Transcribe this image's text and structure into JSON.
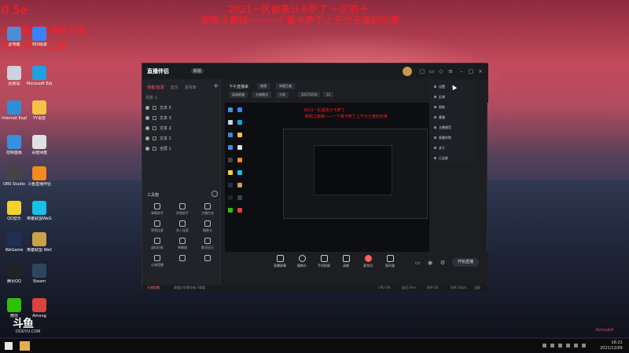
{
  "overlay": {
    "line1": "0.5e",
    "line2": "中国最帅野净胜三盘",
    "line3": "VS大厚 17三盘",
    "line4": "2021一区最高分卡萨丁  一区前十",
    "line5": "昵称之巅峰——一个靠卡萨丁上千分王者的玩家"
  },
  "desktop_icons": [
    {
      "label": "此电脑",
      "color": "#4a8ed6",
      "icon": "computer-icon"
    },
    {
      "label": "360极速",
      "color": "#3b82f6",
      "icon": "browser-icon"
    },
    {
      "label": "回收站",
      "color": "#c8d4e0",
      "icon": "recycle-bin-icon"
    },
    {
      "label": "Microsoft Edge",
      "color": "#1fa0e0",
      "icon": "edge-icon"
    },
    {
      "label": "Internet Explorer",
      "color": "#2d8fd6",
      "icon": "ie-icon"
    },
    {
      "label": "YY语音",
      "color": "#f6c244",
      "icon": "yy-icon"
    },
    {
      "label": "控制面板",
      "color": "#3a8ee0",
      "icon": "control-panel-icon"
    },
    {
      "label": "百度网盘",
      "color": "#e0e0e0",
      "icon": "baidu-netdisk-icon"
    },
    {
      "label": "OBS Studio",
      "color": "#444",
      "icon": "obs-icon"
    },
    {
      "label": "斗鱼直播伴侣",
      "color": "#f58a1f",
      "icon": "douyu-icon"
    },
    {
      "label": "QQ音乐",
      "color": "#f4d22e",
      "icon": "qq-music-icon"
    },
    {
      "label": "英雄联盟WeGame",
      "color": "#17c0e5",
      "icon": "lol-icon"
    },
    {
      "label": "WeGame",
      "color": "#1f2f55",
      "icon": "wegame-icon"
    },
    {
      "label": "英雄联盟 WeGame版",
      "color": "#c8a24c",
      "icon": "lol-wegame-icon"
    },
    {
      "label": "腾讯QQ",
      "color": "#222",
      "icon": "qq-icon"
    },
    {
      "label": "Steam",
      "color": "#2a475e",
      "icon": "steam-icon"
    },
    {
      "label": "微信",
      "color": "#2dc100",
      "icon": "wechat-icon"
    },
    {
      "label": "Among",
      "color": "#d9443b",
      "icon": "among-icon"
    }
  ],
  "window": {
    "title": "直播伴侣",
    "badge": "新版",
    "tabs": [
      "场景/音源",
      "音乐",
      "素材库"
    ],
    "add_scene": "场景 1",
    "sources": [
      "文本 5",
      "文本 3",
      "文本 2",
      "文本 1",
      "全屏 1"
    ],
    "tools_title": "工具箱",
    "tools": [
      "弹幕助手",
      "房管助手",
      "主播任务",
      "视频连麦",
      "多人连麦",
      "摄像头",
      "虚拟形象",
      "弹幕姬",
      "歌词显示",
      "礼物提醒",
      "",
      ""
    ],
    "info_title": "下午直播来",
    "info_chip1": "修改",
    "info_chip2": "申请王者",
    "info_chip3": "英雄联盟",
    "info_chip4": "大神模式",
    "info_chip5": "分享",
    "room_no": "10173216",
    "viewers": "12",
    "menu": [
      "设置",
      "反馈",
      "帮助",
      "客服",
      "主播规范",
      "直播学院",
      "关于",
      "已全屏"
    ],
    "bottom_buttons": [
      "直播屏幕",
      "摄像头",
      "手机投屏",
      "录像",
      "麦克风",
      "扬声器"
    ],
    "start_button": "开始直播",
    "status": [
      "礼物提醒",
      "观看历史等你来下载看",
      "CPU 0%",
      "延迟 0ms",
      "帧率 60",
      "码率 0kb/s"
    ],
    "status_right": "全屏"
  },
  "preview_text": {
    "a": "2021一区最高分卡萨丁",
    "b": "昵称之巅峰——一个靠卡萨丁上千分王者的玩家"
  },
  "taskbar": {
    "time": "16:21",
    "date": "2021/12/09"
  },
  "douyu": {
    "logo": "斗鱼",
    "url": "DOUYU.COM"
  },
  "watermark": "Kerrydoll"
}
